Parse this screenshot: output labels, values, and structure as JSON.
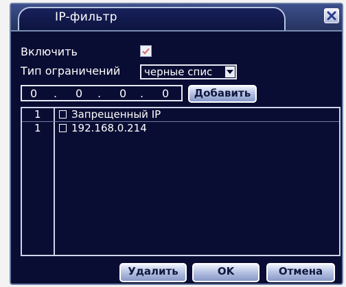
{
  "window": {
    "title": "IP-фильтр",
    "close_icon": "close-x-icon"
  },
  "form": {
    "enable_label": "Включить",
    "enable_checked": true,
    "restriction_label": "Тип ограничений",
    "restriction_value": "черные спис",
    "ip_octets": [
      "0",
      "0",
      "0",
      "0"
    ],
    "add_label": "Добавить"
  },
  "ip_list": {
    "rows": [
      {
        "num": "1",
        "text": "Запрещенный IP"
      },
      {
        "num": "1",
        "text": "192.168.0.214"
      }
    ]
  },
  "footer": {
    "delete_label": "Удалить",
    "ok_label": "OK",
    "cancel_label": "Отмена"
  },
  "colors": {
    "background": "#0a0d33",
    "title_bar": "#3d4f8c",
    "text": "#ffffff",
    "button": "#b8c4e4"
  }
}
